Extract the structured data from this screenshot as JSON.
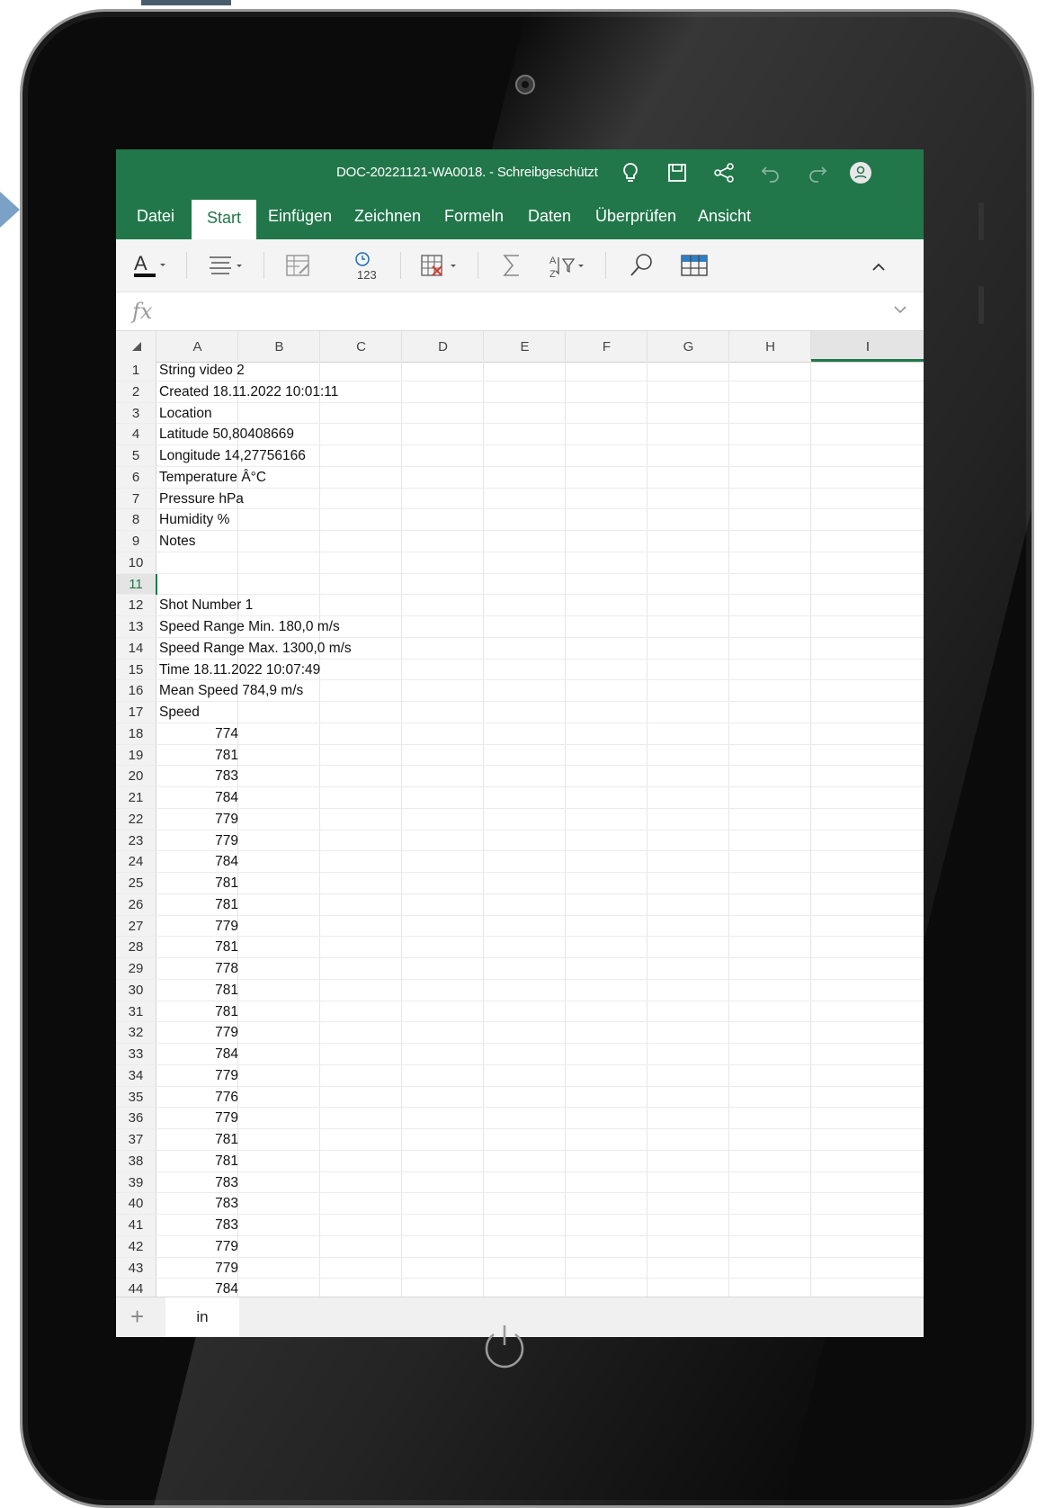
{
  "window": {
    "title": "DOC-20221121-WA0018. - Schreibgeschützt",
    "icons": [
      "lightbulb-icon",
      "save-icon",
      "share-icon",
      "undo-icon",
      "redo-icon",
      "account-icon"
    ]
  },
  "ribbon": {
    "tabs": [
      {
        "label": "Datei"
      },
      {
        "label": "Start",
        "active": true
      },
      {
        "label": "Einfügen"
      },
      {
        "label": "Zeichnen"
      },
      {
        "label": "Formeln"
      },
      {
        "label": "Daten"
      },
      {
        "label": "Überprüfen"
      },
      {
        "label": "Ansicht"
      }
    ],
    "tools": [
      "font-color-icon",
      "align-icon",
      "format-icon",
      "number-format-icon",
      "table-insert-icon",
      "sum-icon",
      "sort-filter-icon",
      "find-icon",
      "table-icon",
      "collapse-ribbon-icon"
    ],
    "accent": "#21774a"
  },
  "formula_bar": {
    "label": "fx",
    "value": ""
  },
  "sheet": {
    "columns": [
      "A",
      "B",
      "C",
      "D",
      "E",
      "F",
      "G",
      "H",
      "I"
    ],
    "selected_column": "I",
    "selected_row": 11,
    "rows": [
      {
        "n": "1",
        "a": "String video 2"
      },
      {
        "n": "2",
        "a": "Created 18.11.2022 10:01:11"
      },
      {
        "n": "3",
        "a": "Location"
      },
      {
        "n": "4",
        "a": "Latitude 50,80408669"
      },
      {
        "n": "5",
        "a": "Longitude 14,27756166"
      },
      {
        "n": "6",
        "a": "Temperature  Â°C"
      },
      {
        "n": "7",
        "a": "Pressure  hPa"
      },
      {
        "n": "8",
        "a": "Humidity  %"
      },
      {
        "n": "9",
        "a": "Notes"
      },
      {
        "n": "10",
        "a": ""
      },
      {
        "n": "11",
        "a": ""
      },
      {
        "n": "12",
        "a": "Shot Number 1"
      },
      {
        "n": "13",
        "a": "Speed Range Min. 180,0 m/s"
      },
      {
        "n": "14",
        "a": "Speed Range Max. 1300,0 m/s"
      },
      {
        "n": "15",
        "a": "Time 18.11.2022 10:07:49"
      },
      {
        "n": "16",
        "a": "Mean Speed 784,9 m/s"
      },
      {
        "n": "17",
        "a": "Speed"
      },
      {
        "n": "18",
        "a": "774",
        "num": true
      },
      {
        "n": "19",
        "a": "781",
        "num": true
      },
      {
        "n": "20",
        "a": "783",
        "num": true
      },
      {
        "n": "21",
        "a": "784",
        "num": true
      },
      {
        "n": "22",
        "a": "779",
        "num": true
      },
      {
        "n": "23",
        "a": "779",
        "num": true
      },
      {
        "n": "24",
        "a": "784",
        "num": true
      },
      {
        "n": "25",
        "a": "781",
        "num": true
      },
      {
        "n": "26",
        "a": "781",
        "num": true
      },
      {
        "n": "27",
        "a": "779",
        "num": true
      },
      {
        "n": "28",
        "a": "781",
        "num": true
      },
      {
        "n": "29",
        "a": "778",
        "num": true
      },
      {
        "n": "30",
        "a": "781",
        "num": true
      },
      {
        "n": "31",
        "a": "781",
        "num": true
      },
      {
        "n": "32",
        "a": "779",
        "num": true
      },
      {
        "n": "33",
        "a": "784",
        "num": true
      },
      {
        "n": "34",
        "a": "779",
        "num": true
      },
      {
        "n": "35",
        "a": "776",
        "num": true
      },
      {
        "n": "36",
        "a": "779",
        "num": true
      },
      {
        "n": "37",
        "a": "781",
        "num": true
      },
      {
        "n": "38",
        "a": "781",
        "num": true
      },
      {
        "n": "39",
        "a": "783",
        "num": true
      },
      {
        "n": "40",
        "a": "783",
        "num": true
      },
      {
        "n": "41",
        "a": "783",
        "num": true
      },
      {
        "n": "42",
        "a": "779",
        "num": true
      },
      {
        "n": "43",
        "a": "779",
        "num": true
      },
      {
        "n": "44",
        "a": "784",
        "num": true
      }
    ]
  },
  "sheet_tabs": {
    "add_label": "+",
    "tabs": [
      "in"
    ]
  },
  "device": {
    "icons": [
      "camera-icon",
      "power-icon"
    ]
  }
}
